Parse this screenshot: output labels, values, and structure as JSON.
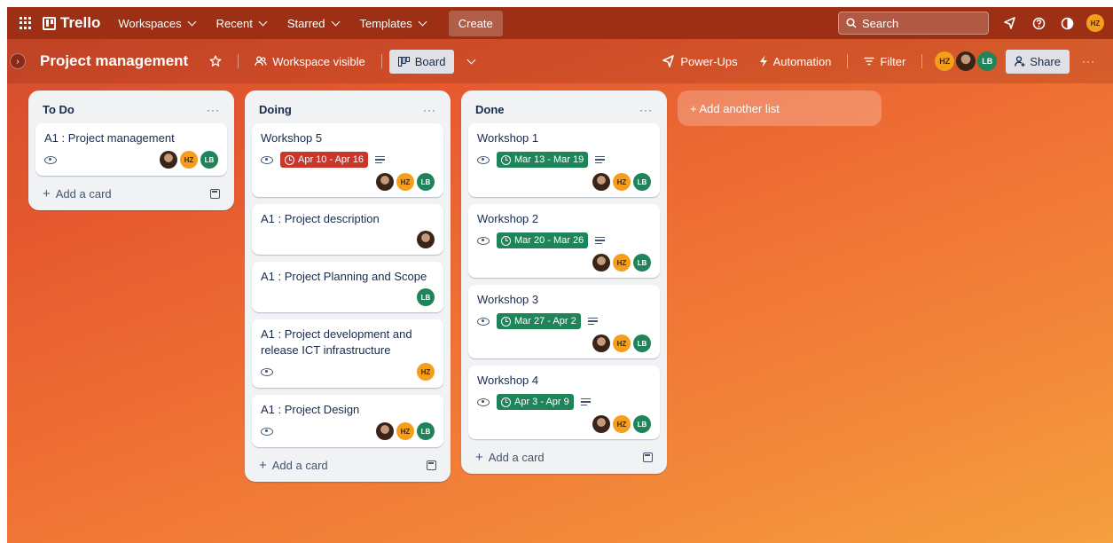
{
  "topnav": {
    "logo_text": "Trello",
    "menus": [
      "Workspaces",
      "Recent",
      "Starred",
      "Templates"
    ],
    "create_label": "Create",
    "search_placeholder": "Search"
  },
  "board": {
    "title": "Project management",
    "visibility_label": "Workspace visible",
    "view_label": "Board",
    "powerups_label": "Power-Ups",
    "automation_label": "Automation",
    "filter_label": "Filter",
    "share_label": "Share",
    "add_list_label": "+ Add another list"
  },
  "lists": [
    {
      "title": "To Do",
      "add_card_label": "Add a card",
      "cards": [
        {
          "title": "A1 : Project management",
          "watch": true,
          "members": [
            "photo",
            "HZ",
            "LB"
          ]
        }
      ]
    },
    {
      "title": "Doing",
      "add_card_label": "Add a card",
      "cards": [
        {
          "title": "Workshop 5",
          "watch": true,
          "date": "Apr 10 - Apr 16",
          "date_status": "overdue",
          "description": true,
          "members": [
            "photo",
            "HZ",
            "LB"
          ]
        },
        {
          "title": "A1 : Project description",
          "members": [
            "photo"
          ]
        },
        {
          "title": "A1 : Project Planning and Scope",
          "members": [
            "LB"
          ]
        },
        {
          "title": "A1 : Project development and release ICT infrastructure",
          "watch": true,
          "members": [
            "HZ"
          ]
        },
        {
          "title": "A1 : Project Design",
          "watch": true,
          "members": [
            "photo",
            "HZ",
            "LB"
          ]
        }
      ]
    },
    {
      "title": "Done",
      "add_card_label": "Add a card",
      "cards": [
        {
          "title": "Workshop 1",
          "watch": true,
          "date": "Mar 13 - Mar 19",
          "date_status": "complete",
          "description": true,
          "members": [
            "photo",
            "HZ",
            "LB"
          ]
        },
        {
          "title": "Workshop 2",
          "watch": true,
          "date": "Mar 20 - Mar 26",
          "date_status": "complete",
          "description": true,
          "members": [
            "photo",
            "HZ",
            "LB"
          ]
        },
        {
          "title": "Workshop 3",
          "watch": true,
          "date": "Mar 27 - Apr 2",
          "date_status": "complete",
          "description": true,
          "members": [
            "photo",
            "HZ",
            "LB"
          ]
        },
        {
          "title": "Workshop 4",
          "watch": true,
          "date": "Apr 3 - Apr 9",
          "date_status": "complete",
          "description": true,
          "members": [
            "photo",
            "HZ",
            "LB"
          ]
        }
      ]
    }
  ],
  "colors": {
    "topbar": "#9d3014",
    "overdue_badge": "#c9372c",
    "complete_badge": "#1f845a",
    "avatar_hz": "#f59e1b",
    "avatar_lb": "#1f845a"
  },
  "icons": [
    "apps-grid-icon",
    "trello-logo-icon",
    "search-icon",
    "megaphone-icon",
    "help-icon",
    "theme-icon",
    "star-icon",
    "people-icon",
    "board-icon",
    "rocket-icon",
    "lightning-icon",
    "filter-icon",
    "share-person-icon",
    "eye-icon",
    "clock-icon",
    "description-icon",
    "template-icon"
  ]
}
